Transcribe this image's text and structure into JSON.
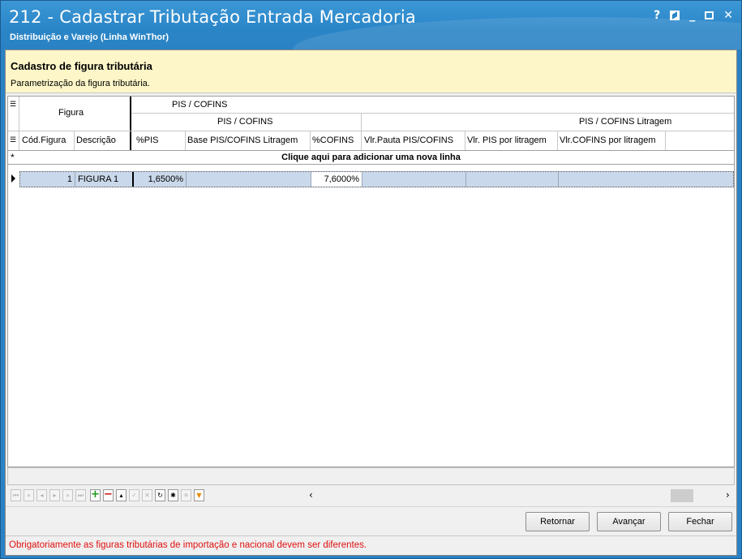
{
  "window": {
    "title": "212 - Cadastrar Tributação Entrada Mercadoria",
    "subtitle": "Distribuição e Varejo (Linha WinThor)",
    "controls": {
      "help": "?",
      "minimize": "_",
      "close": "✕"
    }
  },
  "header_panel": {
    "title": "Cadastro de figura tributária",
    "subtitle": "Parametrização da figura tributária."
  },
  "grid": {
    "bands": {
      "figura": "Figura",
      "pis_cofins_top": "PIS / COFINS",
      "pis_cofins": "PIS / COFINS",
      "pis_cofins_litragem": "PIS / COFINS Litragem"
    },
    "columns": [
      "Cód.Figura",
      "Descrição",
      "%PIS",
      "Base PIS/COFINS Litragem",
      "%COFINS",
      "Vlr.Pauta PIS/COFINS",
      "Vlr. PIS por litragem",
      "Vlr.COFINS por litragem"
    ],
    "new_row_text": "Clique aqui para adicionar uma nova linha",
    "rows": [
      {
        "cod_figura": "1",
        "descricao": "FIGURA 1",
        "pis": "1,6500%",
        "base_pis_cofins_litragem": "",
        "cofins": "7,6000%",
        "vlr_pauta": "",
        "vlr_pis_litragem": "",
        "vlr_cofins_litragem": ""
      }
    ]
  },
  "navigator": {
    "buttons": [
      "first-icon",
      "prev-page-icon",
      "prev-icon",
      "next-icon",
      "next-page-icon",
      "last-icon",
      "add-icon",
      "delete-icon",
      "edit-icon",
      "post-icon",
      "cancel-icon",
      "refresh-icon",
      "bookmark-icon",
      "goto-bookmark-icon",
      "filter-icon"
    ]
  },
  "buttons": {
    "retornar": "Retornar",
    "avancar": "Avançar",
    "fechar": "Fechar"
  },
  "status": {
    "message": "Obrigatoriamente as figuras tributárias de importação e nacional devem ser diferentes.",
    "color": "#e01010"
  },
  "colors": {
    "titlebar": "#2a82c4",
    "header_panel": "#fdf6c8",
    "selected_row": "#c9d8ea"
  }
}
